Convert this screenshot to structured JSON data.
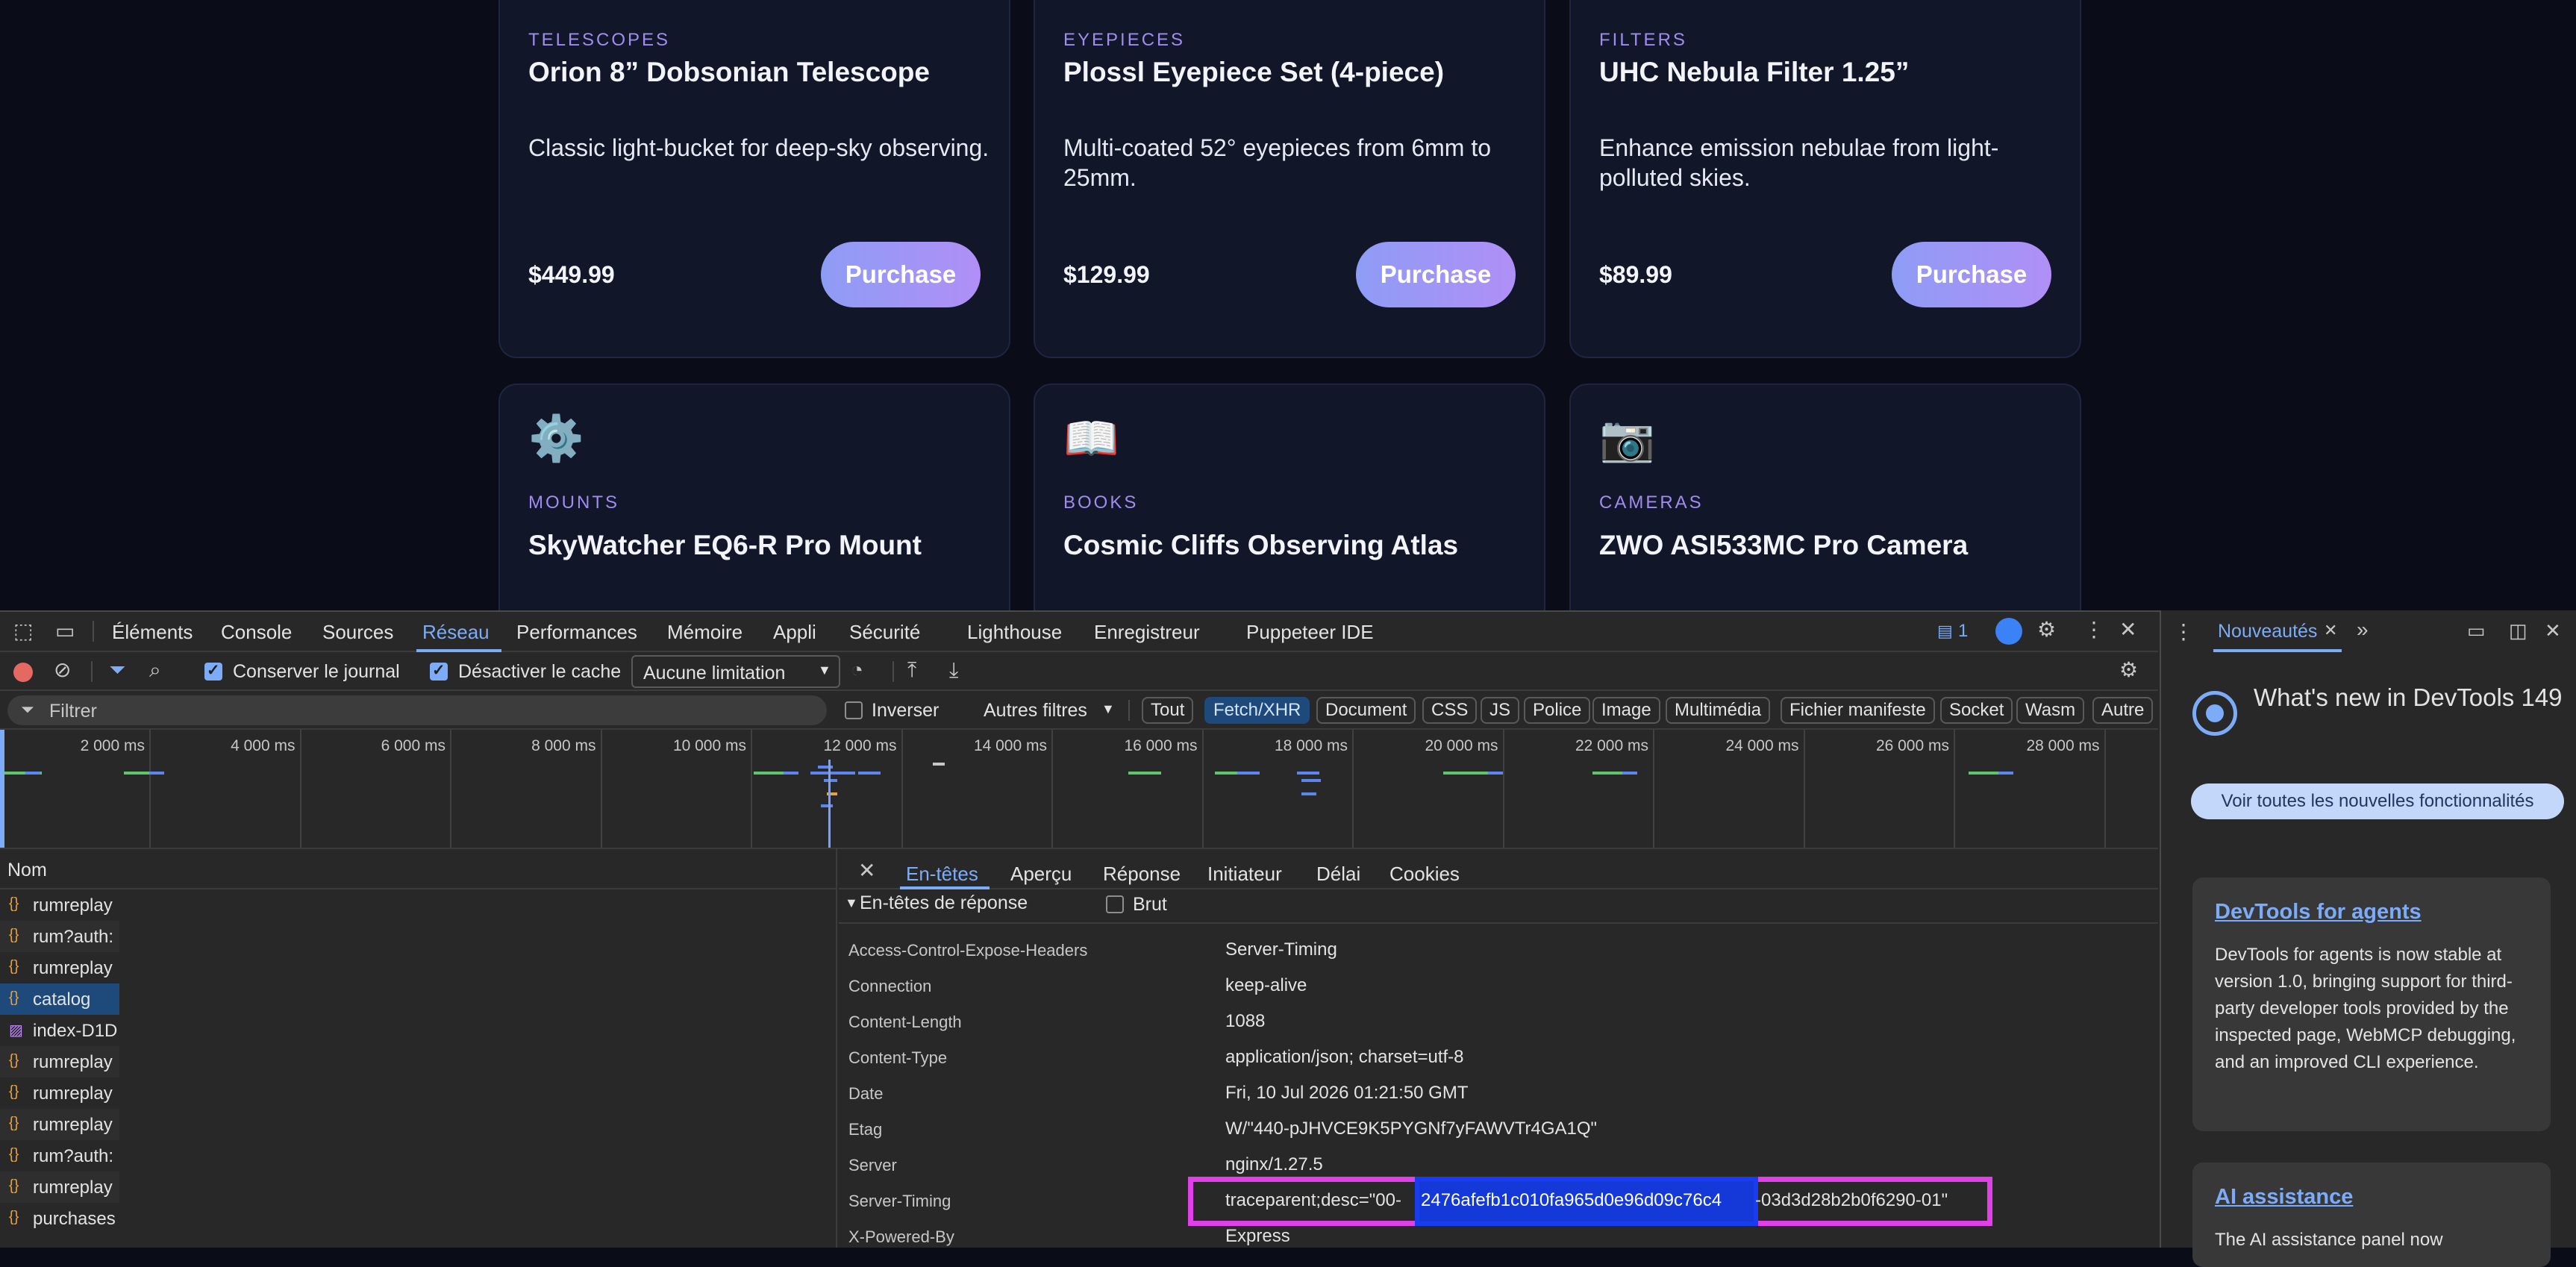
{
  "products": [
    {
      "category": "TELESCOPES",
      "title": "Orion 8” Dobsonian Telescope",
      "desc": "Classic light-bucket for deep-sky observing.",
      "price": "$449.99",
      "button": "Purchase"
    },
    {
      "category": "EYEPIECES",
      "title": "Plossl Eyepiece Set (4-piece)",
      "desc": "Multi-coated 52° eyepieces from 6mm to 25mm.",
      "price": "$129.99",
      "button": "Purchase"
    },
    {
      "category": "FILTERS",
      "title": "UHC Nebula Filter 1.25”",
      "desc": "Enhance emission nebulae from light-polluted skies.",
      "price": "$89.99",
      "button": "Purchase"
    },
    {
      "icon": "⚙️",
      "category": "MOUNTS",
      "title": "SkyWatcher EQ6-R Pro Mount"
    },
    {
      "icon": "📖",
      "category": "BOOKS",
      "title": "Cosmic Cliffs Observing Atlas"
    },
    {
      "icon": "📷",
      "category": "CAMERAS",
      "title": "ZWO ASI533MC Pro Camera"
    }
  ],
  "devtools": {
    "tabs": [
      "Éléments",
      "Console",
      "Sources",
      "Réseau",
      "Performances",
      "Mémoire",
      "Appli",
      "Sécurité",
      "Lighthouse",
      "Enregistreur",
      "Puppeteer IDE"
    ],
    "active_tab": "Réseau",
    "issues_count": "1",
    "toolbar": {
      "preserve_log": "Conserver le journal",
      "disable_cache": "Désactiver le cache",
      "throttling": "Aucune limitation"
    },
    "filter": {
      "placeholder": "Filtrer",
      "invert": "Inverser",
      "more_filters": "Autres filtres",
      "types": [
        "Tout",
        "Fetch/XHR",
        "Document",
        "CSS",
        "JS",
        "Police",
        "Image",
        "Multimédia",
        "Fichier manifeste",
        "Socket",
        "Wasm",
        "Autre"
      ],
      "active_type": "Fetch/XHR"
    },
    "timeline_ticks": [
      "2 000 ms",
      "4 000 ms",
      "6 000 ms",
      "8 000 ms",
      "10 000 ms",
      "12 000 ms",
      "14 000 ms",
      "16 000 ms",
      "18 000 ms",
      "20 000 ms",
      "22 000 ms",
      "24 000 ms",
      "26 000 ms",
      "28 000 ms"
    ],
    "requests_header": "Nom",
    "requests": [
      "rumreplay",
      "rum?auth:",
      "rumreplay",
      "catalog",
      "index-D1D",
      "rumreplay",
      "rumreplay",
      "rumreplay",
      "rum?auth:",
      "rumreplay",
      "purchases"
    ],
    "selected_request": "catalog",
    "detail_tabs": [
      "En-têtes",
      "Aperçu",
      "Réponse",
      "Initiateur",
      "Délai",
      "Cookies"
    ],
    "active_detail_tab": "En-têtes",
    "section_title": "En-têtes de réponse",
    "raw_label": "Brut",
    "headers": [
      {
        "k": "Access-Control-Expose-Headers",
        "v": "Server-Timing"
      },
      {
        "k": "Connection",
        "v": "keep-alive"
      },
      {
        "k": "Content-Length",
        "v": "1088"
      },
      {
        "k": "Content-Type",
        "v": "application/json; charset=utf-8"
      },
      {
        "k": "Date",
        "v": "Fri, 10 Jul 2026 01:21:50 GMT"
      },
      {
        "k": "Etag",
        "v": "W/\"440-pJHVCE9K5PYGNf7yFAWVTr4GA1Q\""
      },
      {
        "k": "Server",
        "v": "nginx/1.27.5"
      },
      {
        "k": "Server-Timing",
        "v_pre": "traceparent;desc=\"00-",
        "v_trace": "2476afefb1c010fa965d0e96d09c76c4",
        "v_post": "-03d3d28b2b0f6290-01\""
      },
      {
        "k": "X-Powered-By",
        "v": "Express"
      }
    ],
    "side_panel": {
      "tab": "Nouveautés",
      "title": "What's new in DevTools 149",
      "button": "Voir toutes les nouvelles fonctionnalités",
      "card1_title": "DevTools for agents",
      "card1_body": "DevTools for agents is now stable at version 1.0, bringing support for third-party developer tools provided by the inspected page, WebMCP debugging, and an improved CLI experience.",
      "card2_title": "AI assistance",
      "card2_body": "The AI assistance panel now"
    },
    "colors": {
      "accent": "#7cacf8",
      "highlight_magenta": "#e040e8",
      "highlight_blue": "#1a3cf0"
    }
  }
}
